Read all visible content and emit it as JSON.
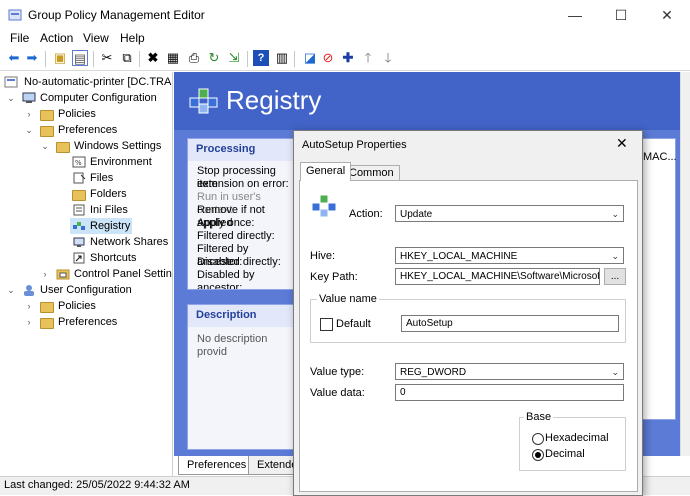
{
  "window": {
    "title": "Group Policy Management Editor",
    "minimize": "—",
    "maximize": "☐",
    "close": "✕"
  },
  "menu": [
    "File",
    "Action",
    "View",
    "Help"
  ],
  "tree": {
    "root": "No-automatic-printer [DC.TRAI",
    "computer_config": "Computer Configuration",
    "policies": "Policies",
    "preferences": "Preferences",
    "windows_settings": "Windows Settings",
    "environment": "Environment",
    "files": "Files",
    "folders": "Folders",
    "ini_files": "Ini Files",
    "registry": "Registry",
    "network_shares": "Network Shares",
    "shortcuts": "Shortcuts",
    "control_panel": "Control Panel Setting",
    "user_config": "User Configuration",
    "user_policies": "Policies",
    "user_preferences": "Preferences"
  },
  "registry": {
    "title": "Registry",
    "processing_header": "Processing",
    "processing_lines": [
      "Stop processing item",
      "extension on error:",
      "Run in user's context:",
      "Remove if not applied",
      "Apply once:",
      "Filtered directly:",
      "Filtered by ancestor:",
      "Disabled directly:",
      "Disabled by ancestor:"
    ],
    "description_header": "Description",
    "description_text": "No description provid",
    "list_fragment": "MAC..."
  },
  "bottom_tabs": [
    "Preferences",
    "Extended"
  ],
  "status": "Last changed: 25/05/2022 9:44:32 AM",
  "dialog": {
    "title": "AutoSetup Properties",
    "close": "✕",
    "tabs": [
      "General",
      "Common"
    ],
    "action_label": "Action:",
    "action_value": "Update",
    "hive_label": "Hive:",
    "hive_value": "HKEY_LOCAL_MACHINE",
    "keypath_label": "Key Path:",
    "keypath_value": "HKEY_LOCAL_MACHINE\\Software\\Microsoft\\W",
    "browse": "...",
    "value_name_group": "Value name",
    "default_label": "Default",
    "default_checked": false,
    "value_name": "AutoSetup",
    "value_type_label": "Value type:",
    "value_type": "REG_DWORD",
    "value_data_label": "Value data:",
    "value_data": "0",
    "base_group": "Base",
    "base_hex": "Hexadecimal",
    "base_dec": "Decimal",
    "base_selected": "Decimal"
  },
  "icons": [
    "back-icon",
    "forward-icon",
    "up-folder-icon",
    "show-hide-tree-icon",
    "cut-icon",
    "copy-icon",
    "delete-icon",
    "properties-icon",
    "print-icon",
    "refresh-icon",
    "export-icon",
    "help-icon",
    "show-hide-action-icon",
    "new-item-icon",
    "block-icon",
    "add-icon",
    "move-up-icon",
    "move-down-icon"
  ]
}
